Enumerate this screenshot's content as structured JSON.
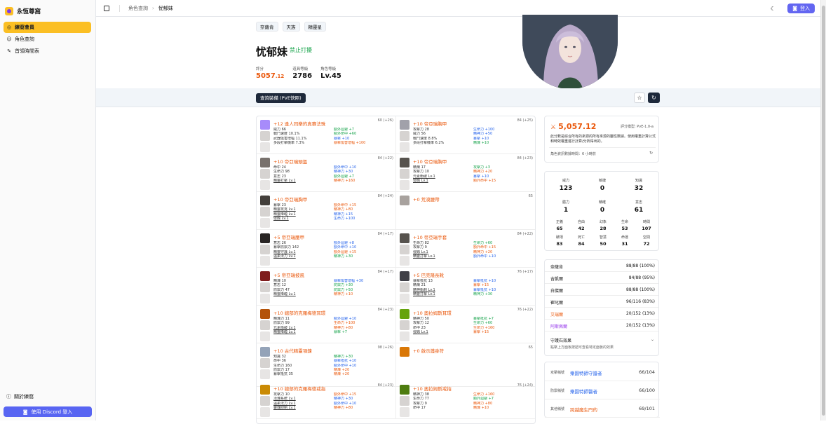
{
  "sidebar": {
    "brand": "永恆尊窩",
    "nav": [
      {
        "label": "練窩會員",
        "icon": "circle-icon",
        "active": true
      },
      {
        "label": "角色查詢",
        "icon": "user-icon",
        "active": false
      },
      {
        "label": "首領時間表",
        "icon": "pen-icon",
        "active": false
      }
    ],
    "about": "關於練窩",
    "discord_login": "使用 Discord 登入"
  },
  "topbar": {
    "breadcrumb": [
      "角色查詢",
      "忧郁妹"
    ],
    "login": "登入"
  },
  "character": {
    "tags": [
      "奈薩肯",
      "天族",
      "精靈星"
    ],
    "name": "忧郁妹",
    "status": "禁止打擾",
    "score_label": "評分",
    "score_main": "5057",
    "score_dec": ".12",
    "equip_label": "道具等級",
    "equip_value": "2786",
    "level_label": "角色等級",
    "level_value": "Lv.45"
  },
  "toolbar": {
    "equip_button": "查詢裝備 (PVE快照)"
  },
  "equipment": [
    {
      "name": "+12 逢人同樂的真賽法珠",
      "lvl": "60 (+26)",
      "left": [
        "威力 66",
        "戰鬥速度 10.1%",
        "武器傷害增幅 11.1%",
        "多段打擊機率 7.3%"
      ],
      "right": [
        [
          "額外迴避 +7",
          "green"
        ],
        [
          "額外命中 +60",
          "green"
        ],
        [
          "暴擊 +10",
          "blue"
        ],
        [
          "暴擊傷害增幅 +100",
          "orange"
        ]
      ],
      "color": "#a78bfa"
    },
    {
      "name": "+10 帝亞瑞胸甲",
      "lvl": "84 (+25)",
      "left": [
        "攻擊力 28",
        "威力 56",
        "戰鬥速度 8.8%",
        "多段打擊機率 6.2%"
      ],
      "right": [
        [
          "生命力 +100",
          "blue"
        ],
        [
          "精神力 +50",
          "blue"
        ],
        [
          "暴擊 +10",
          "blue"
        ],
        [
          "精煉 +10",
          "green"
        ]
      ],
      "color": "#a1a1aa"
    },
    {
      "name": "+10 帝亞瑞頭盔",
      "lvl": "84 (+22)",
      "left": [
        "命中 24",
        "生命力 98",
        "意志 23",
        "精靈打擊 Lv.1"
      ],
      "right": [
        [
          "額外命中 +10",
          "blue"
        ],
        [
          "精神力 +30",
          "blue"
        ],
        [
          "額外迴避 +7",
          "green"
        ],
        [
          "精神力 +160",
          "orange"
        ]
      ],
      "color": "#78716c"
    },
    {
      "name": "+10 帝亞瑞胸甲",
      "lvl": "84 (+23)",
      "left": [
        "精煉 17",
        "攻擊力 10",
        "元素衝破 Lv.1",
        "侵蝕 Lv.1"
      ],
      "right": [
        [
          "攻擊力 +3",
          "green"
        ],
        [
          "精神力 +20",
          "orange"
        ],
        [
          "暴擊 +10",
          "blue"
        ],
        [
          "額外命中 +15",
          "orange"
        ]
      ],
      "color": "#57534e"
    },
    {
      "name": "+10 帝亞瑞胸甲",
      "lvl": "84 (+24)",
      "left": [
        "暴擊 23",
        "精靈攻克 Lv.1",
        "精靈降臨 Lv.1",
        "侵蝕 Lv.1"
      ],
      "right": [
        [
          "額外命中 +15",
          "orange"
        ],
        [
          "精神力 +80",
          "orange"
        ],
        [
          "精神力 +15",
          "blue"
        ],
        [
          "生命力 +100",
          "blue"
        ]
      ],
      "color": "#44403c"
    },
    {
      "name": "+0 荒漠腰帶",
      "lvl": "65",
      "left": [],
      "right": [],
      "color": "#a8a29e"
    },
    {
      "name": "+5 帝亞瑞腰甲",
      "lvl": "84 (+17)",
      "left": [
        "意志 26",
        "暴擊防禦力 142",
        "精靈守護 Lv.1",
        "溫柔法力 Lv.1"
      ],
      "right": [
        [
          "額外迴避 +8",
          "blue"
        ],
        [
          "額外命中 +10",
          "blue"
        ],
        [
          "額外迴避 +15",
          "orange"
        ],
        [
          "精神力 +30",
          "green"
        ]
      ],
      "color": "#292524"
    },
    {
      "name": "+10 帝亞瑞手套",
      "lvl": "84 (+22)",
      "left": [
        "生命力 82",
        "攻擊力 9",
        "侵蝕 Lv.1",
        "精靈打擊 Lv.1"
      ],
      "right": [
        [
          "生命力 +60",
          "green"
        ],
        [
          "額外命中 +15",
          "orange"
        ],
        [
          "精神力 +20",
          "orange"
        ],
        [
          "額外命中 +10",
          "blue"
        ]
      ],
      "color": "#57534e"
    },
    {
      "name": "+5 帝亞瑞披風",
      "lvl": "84 (+17)",
      "left": [
        "精煉 10",
        "意志 12",
        "防禦力 47",
        "精靈降臨 Lv.1"
      ],
      "right": [
        [
          "暴擊傷害增幅 +30",
          "blue"
        ],
        [
          "防禦力 +30",
          "green"
        ],
        [
          "防禦力 +50",
          "green"
        ],
        [
          "精神力 +10",
          "orange"
        ]
      ],
      "color": "#7f1d1d"
    },
    {
      "name": "+5 巴克隆長靴",
      "lvl": "76 (+17)",
      "left": [
        "暴擊抵抗 13",
        "精煉 21",
        "精神衝刺 Lv.1",
        "精靈打擊 Lv.1"
      ],
      "right": [
        [
          "暴擊抵抗 +10",
          "blue"
        ],
        [
          "暴擊 +15",
          "orange"
        ],
        [
          "暴擊抵抗 +10",
          "blue"
        ],
        [
          "精神力 +30",
          "green"
        ]
      ],
      "color": "#3f3f46"
    },
    {
      "name": "+10 總部的克羅梅德耳環",
      "lvl": "84 (+23)",
      "left": [
        "精煉力 11",
        "防禦力 99",
        "元素衝破 Lv.1",
        "精靈降臨 Lv.1"
      ],
      "right": [
        [
          "額外迴避 +10",
          "blue"
        ],
        [
          "生命力 +100",
          "orange"
        ],
        [
          "精神力 +80",
          "orange"
        ],
        [
          "暴擊 +7",
          "green"
        ]
      ],
      "color": "#b45309"
    },
    {
      "name": "+10 奧拉姆斯耳環",
      "lvl": "76 (+22)",
      "left": [
        "精神力 50",
        "攻擊力 12",
        "命中 23",
        "侵蝕 Lv.1"
      ],
      "right": [
        [
          "暴擊抵抗 +7",
          "green"
        ],
        [
          "生命力 +60",
          "green"
        ],
        [
          "生命力 +160",
          "orange"
        ],
        [
          "暴擊 +15",
          "orange"
        ]
      ],
      "color": "#65a30d"
    },
    {
      "name": "+10 古代精靈項鍊",
      "lvl": "98 (+26)",
      "left": [
        "知識 32",
        "命中 36",
        "生命力 160",
        "防禦力 17",
        "暴擊抵抗 35"
      ],
      "right": [
        [
          "精神力 +30",
          "green"
        ],
        [
          "暴擊抵抗 +10",
          "blue"
        ],
        [
          "額外命中 +10",
          "blue"
        ],
        [
          "精煉 +20",
          "orange"
        ],
        [
          "精煉 +20",
          "orange"
        ]
      ],
      "color": "#94a3b8"
    },
    {
      "name": "+0 啟示護身符",
      "lvl": "65",
      "left": [],
      "right": [],
      "color": "#d97706"
    },
    {
      "name": "+10 總部的克羅梅德戒指",
      "lvl": "84 (+23)",
      "left": [
        "攻擊力 10",
        "冶煉系統 Lv.1",
        "溫柔法力 Lv.1",
        "靈魂抑制 Lv.1"
      ],
      "right": [
        [
          "額外命中 +15",
          "orange"
        ],
        [
          "精神力 +30",
          "blue"
        ],
        [
          "額外命中 +10",
          "blue"
        ],
        [
          "精神力 +80",
          "orange"
        ]
      ],
      "color": "#ca8a04"
    },
    {
      "name": "+10 奧拉姆斯戒指",
      "lvl": "76 (+24)",
      "left": [
        "精神力 38",
        "生命力 77",
        "攻擊力 9",
        "命中 17"
      ],
      "right": [
        [
          "生命力 +160",
          "orange"
        ],
        [
          "額外迴避 +7",
          "green"
        ],
        [
          "精神力 +80",
          "orange"
        ],
        [
          "精煉 +10",
          "orange"
        ]
      ],
      "color": "#4d7c0f"
    }
  ],
  "score_card": {
    "value": "5,057.12",
    "model": "評分模型: PvE-1.0-a",
    "desc": "此分數是綜合所有的來源的所有來源的屬性數據。使用權重計算公式和時效權重進行計算/分析得出的。",
    "updated": "角色資訊數據時間：6 小時前"
  },
  "attributes": {
    "main": [
      {
        "label": "威力",
        "value": "123"
      },
      {
        "label": "敏捷",
        "value": "0"
      },
      {
        "label": "知識",
        "value": "32"
      },
      {
        "label": "體力",
        "value": "1"
      },
      {
        "label": "精確",
        "value": "0"
      },
      {
        "label": "意志",
        "value": "61"
      }
    ],
    "sub": [
      {
        "label": "正義",
        "value": "65"
      },
      {
        "label": "自由",
        "value": "42"
      },
      {
        "label": "幻象",
        "value": "28"
      },
      {
        "label": "生命",
        "value": "53"
      },
      {
        "label": "時間",
        "value": "107"
      },
      {
        "label": "破壞",
        "value": "83"
      },
      {
        "label": "死亡",
        "value": "84"
      },
      {
        "label": "智慧",
        "value": "50"
      },
      {
        "label": "命運",
        "value": "31"
      },
      {
        "label": "空間",
        "value": "72"
      }
    ]
  },
  "progress": [
    {
      "name": "奈薩肯",
      "value": "88/88 (100%)",
      "color": ""
    },
    {
      "name": "吉凱爾",
      "value": "84/88 (95%)",
      "color": ""
    },
    {
      "name": "白傑爾",
      "value": "88/88 (100%)",
      "color": ""
    },
    {
      "name": "崔叱爾",
      "value": "96/116 (83%)",
      "color": ""
    },
    {
      "name": "艾瑞爾",
      "value": "20/152 (13%)",
      "color": "orange"
    },
    {
      "name": "阿斯佩爾",
      "value": "20/152 (13%)",
      "color": "purple"
    }
  ],
  "guardian": {
    "title": "守護石效果",
    "subtitle": "點擊上方面板按鈕可查看特定面板的效果"
  },
  "titles": [
    {
      "kind": "攻擊稱號",
      "title": "樂園特師守護者",
      "count": "66/104",
      "color": "blue"
    },
    {
      "kind": "防禦稱號",
      "title": "樂園特師醫者",
      "count": "66/100",
      "color": "blue"
    },
    {
      "kind": "其他稱號",
      "title": "跨越魔生門的",
      "count": "69/101",
      "color": "orange"
    }
  ]
}
